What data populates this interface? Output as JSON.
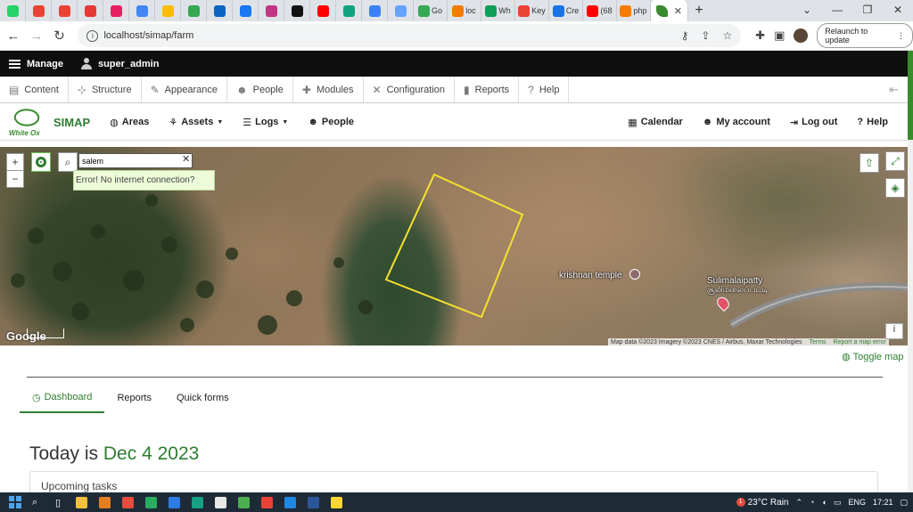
{
  "browser": {
    "tabs": [
      {
        "icon": "whatsapp-icon",
        "color": "#25d366",
        "label": ""
      },
      {
        "icon": "gmail-icon",
        "color": "#ea4335",
        "label": ""
      },
      {
        "icon": "gmail-icon",
        "color": "#ea4335",
        "label": ""
      },
      {
        "icon": "red-circle-icon",
        "color": "#e53935",
        "label": ""
      },
      {
        "icon": "wand-icon",
        "color": "#e91e63",
        "label": ""
      },
      {
        "icon": "google-icon",
        "color": "#4285f4",
        "label": ""
      },
      {
        "icon": "drive-icon",
        "color": "#fbbc04",
        "label": ""
      },
      {
        "icon": "chat-icon",
        "color": "#34a853",
        "label": ""
      },
      {
        "icon": "linkedin-icon",
        "color": "#0a66c2",
        "label": ""
      },
      {
        "icon": "facebook-icon",
        "color": "#1877f2",
        "label": ""
      },
      {
        "icon": "instagram-icon",
        "color": "#c13584",
        "label": ""
      },
      {
        "icon": "x-icon",
        "color": "#111111",
        "label": ""
      },
      {
        "icon": "youtube-icon",
        "color": "#ff0000",
        "label": ""
      },
      {
        "icon": "openai-icon",
        "color": "#10a37f",
        "label": ""
      },
      {
        "icon": "copilot-icon",
        "color": "#3b82f6",
        "label": ""
      },
      {
        "icon": "translate-icon",
        "color": "#66a3ff",
        "label": ""
      },
      {
        "icon": "google-doc-icon",
        "color": "#34a853",
        "label": "Go"
      },
      {
        "icon": "xampp-icon",
        "color": "#f57c00",
        "label": "loc"
      },
      {
        "icon": "sheets-icon",
        "color": "#0f9d58",
        "label": "Wh"
      },
      {
        "icon": "maps-pin-icon",
        "color": "#ea4335",
        "label": "Key"
      },
      {
        "icon": "api-icon",
        "color": "#1a73e8",
        "label": "Cre"
      },
      {
        "icon": "youtube-icon",
        "color": "#ff0000",
        "label": "(68"
      },
      {
        "icon": "xampp-icon",
        "color": "#f57c00",
        "label": "php"
      }
    ],
    "active_tab_icon": "leaf-icon",
    "active_tab_color": "#3a8a2e",
    "url": "localhost/simap/farm",
    "relaunch_label": "Relaunch to update"
  },
  "admin_toolbar": {
    "manage_label": "Manage",
    "user_label": "super_admin",
    "menu": [
      {
        "label": "Content",
        "icon": "document-icon",
        "glyph": "▤"
      },
      {
        "label": "Structure",
        "icon": "structure-icon",
        "glyph": "⊹"
      },
      {
        "label": "Appearance",
        "icon": "brush-icon",
        "glyph": "✎"
      },
      {
        "label": "People",
        "icon": "people-icon",
        "glyph": "☻"
      },
      {
        "label": "Modules",
        "icon": "puzzle-icon",
        "glyph": "✚"
      },
      {
        "label": "Configuration",
        "icon": "wrench-icon",
        "glyph": "✕"
      },
      {
        "label": "Reports",
        "icon": "bar-chart-icon",
        "glyph": "▮"
      },
      {
        "label": "Help",
        "icon": "help-icon",
        "glyph": "?"
      }
    ]
  },
  "site_nav": {
    "logo_text": "White Ox",
    "brand": "SIMAP",
    "items": [
      {
        "label": "Areas",
        "glyph": "◍"
      },
      {
        "label": "Assets",
        "glyph": "⚘"
      },
      {
        "label": "Logs",
        "glyph": "☰"
      },
      {
        "label": "People",
        "glyph": "☻"
      }
    ],
    "right_items": [
      {
        "label": "Calendar",
        "glyph": "▦"
      },
      {
        "label": "My account",
        "glyph": "☻"
      },
      {
        "label": "Log out",
        "glyph": "⇥"
      },
      {
        "label": "Help",
        "glyph": "?"
      }
    ]
  },
  "map": {
    "zoom_in": "+",
    "zoom_out": "−",
    "search_value": "salem",
    "error_text": "Error! No internet connection?",
    "poi_label": "krishnan temple",
    "place_label": "Sulimalaipatty",
    "place_label_local": "சூலிமலைப்பட்டி",
    "google_text": "Google",
    "attribution": [
      "Map data ©2023 Imagery ©2023 CNES / Airbus, Maxar Technologies",
      "Terms",
      "Report a map error"
    ],
    "info_label": "i",
    "polygon_color": "#f5e12f"
  },
  "toggle_map_label": "Toggle map",
  "tabs": [
    {
      "label": "Dashboard",
      "active": true
    },
    {
      "label": "Reports",
      "active": false
    },
    {
      "label": "Quick forms",
      "active": false
    }
  ],
  "today": {
    "prefix": "Today is",
    "date": "Dec 4 2023"
  },
  "upcoming_tasks_label": "Upcoming tasks",
  "taskbar": {
    "apps": [
      "#f3c13a",
      "#e67e22",
      "#e74c3c",
      "#27ae60",
      "#2c7be5",
      "#16a085",
      "#e8e8e8",
      "#4caf50",
      "#ea4335",
      "#1e88e5",
      "#2b579a",
      "#fdd835"
    ],
    "weather_temp": "23°C",
    "weather_text": "Rain",
    "notif_count": "1",
    "lang": "ENG",
    "time": "17:21"
  }
}
